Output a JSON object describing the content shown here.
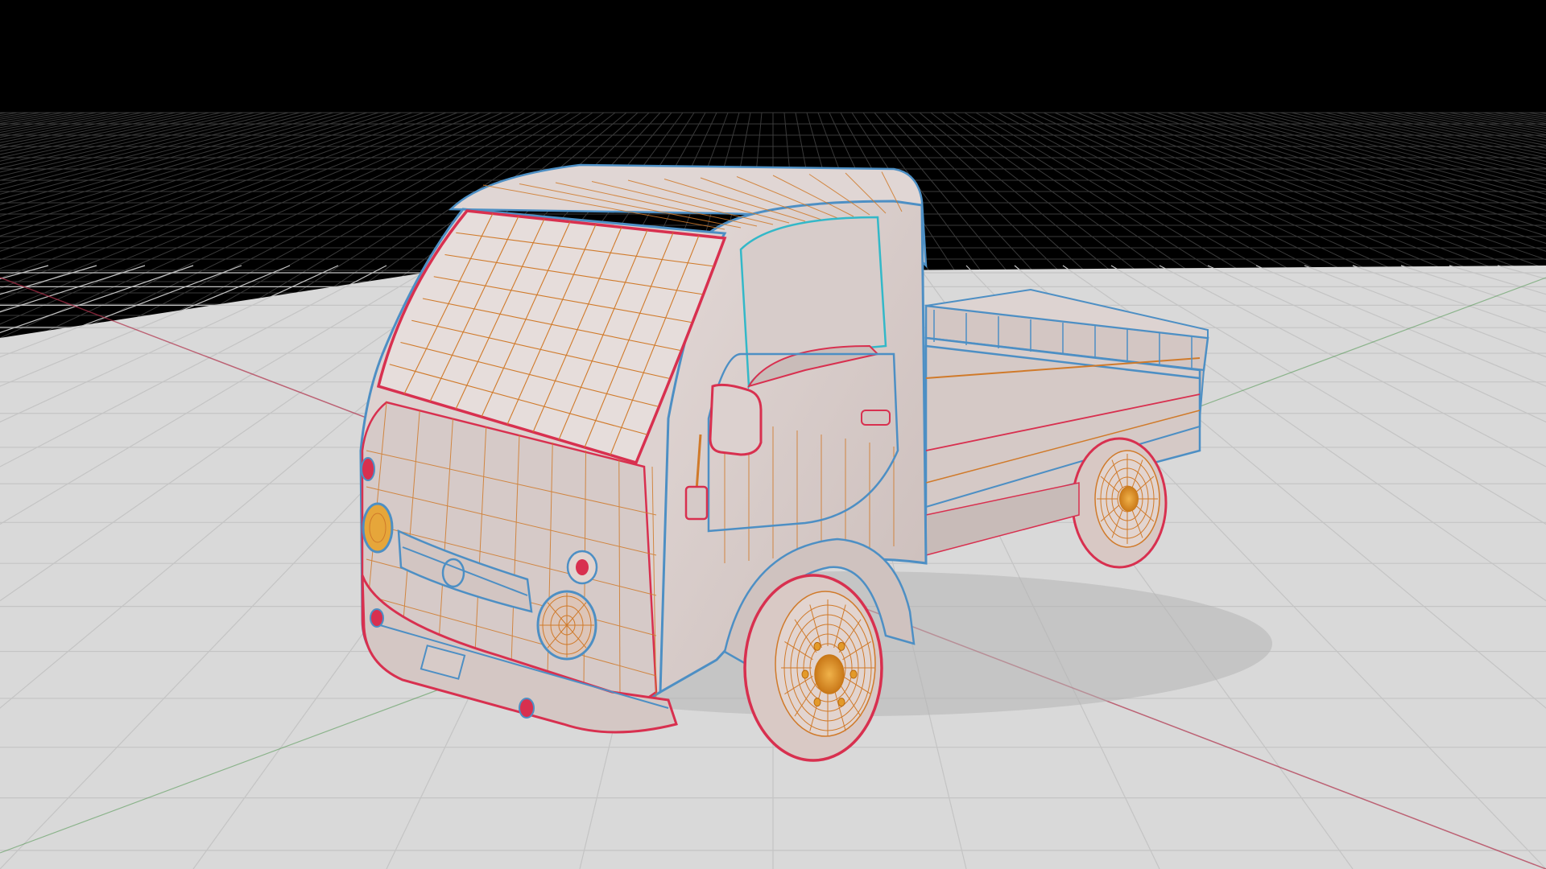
{
  "viewport": {
    "kind": "3d-viewport",
    "shading": "wireframe-on-solid",
    "colors": {
      "background": "#000000",
      "floor": "#d9d9d9",
      "floor_grid": "#bdbdbd",
      "void_grid": "#3a3a3a",
      "x_axis": "#b0304a",
      "y_axis": "#3f8f3f",
      "mesh_fill": "#d9cdca",
      "mesh_shadow": "#b8aaa7",
      "edge_orange": "#d07a2a",
      "edge_red": "#d8304f",
      "edge_blue": "#4d8fc4",
      "edge_cyan": "#33b8c8",
      "wheel_core": "#e39a2a",
      "tire": "#e2d4cf"
    }
  },
  "model": {
    "name_icon": "pickup-truck-mesh",
    "parts": [
      "cab",
      "windshield",
      "side-window",
      "door",
      "mirror",
      "grille",
      "headlights",
      "bumper",
      "cargo-bed",
      "front-wheel",
      "rear-wheel"
    ]
  }
}
